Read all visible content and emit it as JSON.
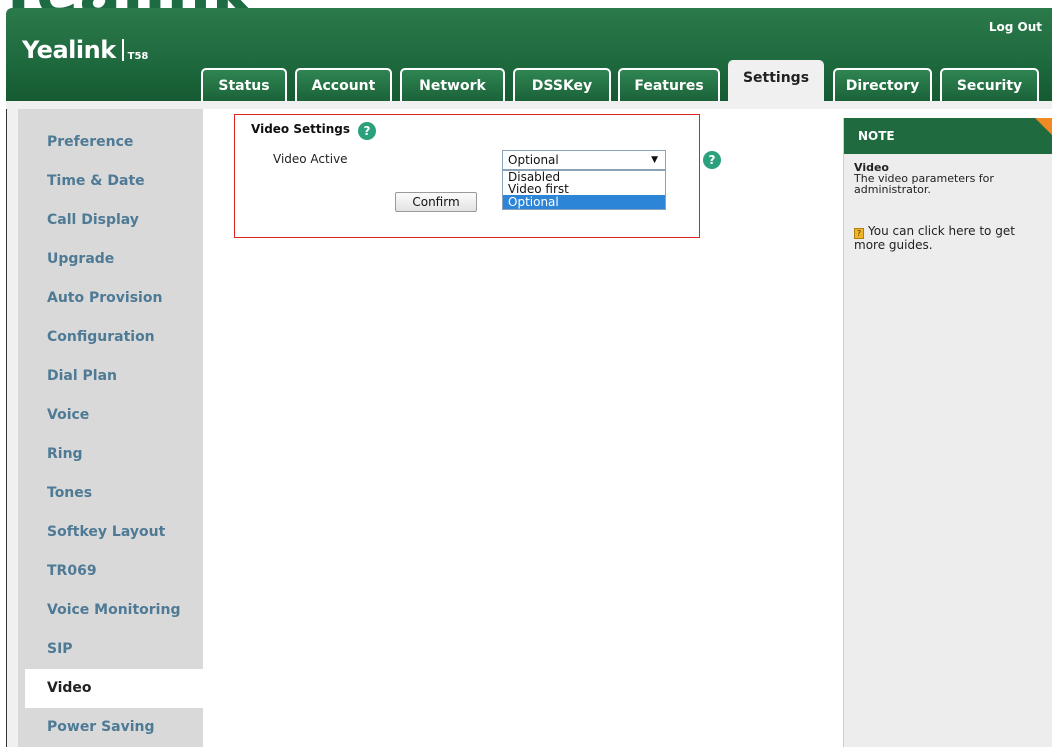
{
  "brand": {
    "logo": "Yealink",
    "model": "T58"
  },
  "header": {
    "logout_label": "Log Out"
  },
  "tabs": [
    {
      "label": "Status",
      "active": false
    },
    {
      "label": "Account",
      "active": false
    },
    {
      "label": "Network",
      "active": false
    },
    {
      "label": "DSSKey",
      "active": false
    },
    {
      "label": "Features",
      "active": false
    },
    {
      "label": "Settings",
      "active": true
    },
    {
      "label": "Directory",
      "active": false
    },
    {
      "label": "Security",
      "active": false
    }
  ],
  "sidebar": {
    "items": [
      {
        "label": "Preference"
      },
      {
        "label": "Time & Date"
      },
      {
        "label": "Call Display"
      },
      {
        "label": "Upgrade"
      },
      {
        "label": "Auto Provision"
      },
      {
        "label": "Configuration"
      },
      {
        "label": "Dial Plan"
      },
      {
        "label": "Voice"
      },
      {
        "label": "Ring"
      },
      {
        "label": "Tones"
      },
      {
        "label": "Softkey Layout"
      },
      {
        "label": "TR069"
      },
      {
        "label": "Voice Monitoring"
      },
      {
        "label": "SIP"
      },
      {
        "label": "Video",
        "active": true
      },
      {
        "label": "Power Saving"
      }
    ]
  },
  "video_settings": {
    "title": "Video Settings",
    "field_label": "Video Active",
    "selected_value": "Optional",
    "options": [
      "Disabled",
      "Video first",
      "Optional"
    ],
    "confirm_label": "Confirm"
  },
  "note": {
    "heading": "NOTE",
    "subtitle": "Video",
    "description": "The video parameters for administrator.",
    "guide_text": "You can click here to get more guides."
  },
  "colors": {
    "header_green": "#1f6a3f",
    "sidebar_link": "#4e7a95",
    "highlight_box": "#dd2222",
    "help_icon": "#2aa07c",
    "dropdown_selected": "#2d85d8",
    "note_corner": "#f08a24"
  }
}
